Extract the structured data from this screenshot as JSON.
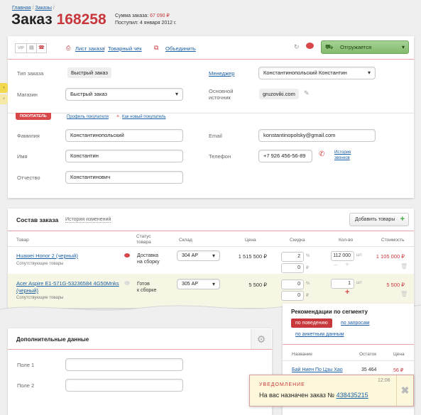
{
  "breadcrumb": [
    "Главная",
    "Заказы",
    "Заказ"
  ],
  "order": {
    "title_word": "Заказ",
    "number": "168258",
    "sum_label": "Сумма заказа:",
    "sum_value": "67 090 ₽",
    "received": "Поступил: 4 января 2012 г."
  },
  "toolbar": {
    "vip": "VIP",
    "order_sheet": "Лист заказа",
    "sep": "/",
    "receipt": "Товарный чек",
    "merge": "Объединить",
    "status": "Отгружается"
  },
  "info": {
    "type_label": "Тип заказа",
    "type_value": "Быстрый заказ",
    "store_label": "Магазин",
    "store_value": "Быстрый заказ",
    "manager_label": "Менеджер",
    "manager_value": "Константинопольский Константин",
    "source_label_1": "Основной",
    "source_label_2": "источник",
    "source_value": "gruzoviki.com"
  },
  "buyer": {
    "badge": "ПОКУПАТЕЛЬ",
    "profile_link": "Профиль покупателя",
    "new_link": "Как новый покупатель",
    "surname_label": "Фамилия",
    "surname_value": "Константинопольский",
    "name_label": "Имя",
    "name_value": "Константин",
    "patronymic_label": "Отчество",
    "patronymic_value": "Константинович",
    "email_label": "Email",
    "email_value": "konstantinopolsky@gmail.com",
    "phone_label": "Телефон",
    "phone_value": "+7 926 456-56-89",
    "call_history_1": "История",
    "call_history_2": "звонков"
  },
  "composition": {
    "title": "Состав заказа",
    "history": "История изменений",
    "add_button": "Добавить товары",
    "headers": {
      "item": "Товар",
      "status_1": "Статус",
      "status_2": "товара",
      "warehouse": "Склад",
      "price": "Цена",
      "discount": "Скидка",
      "qty": "Кол-во",
      "cost": "Стоимость"
    },
    "rows": [
      {
        "name": "Huawei Honor 2 (черный)",
        "related": "Сопутствующие товары",
        "status_1": "Доставка",
        "status_2": "на сборку",
        "warehouse": "304 АР",
        "price": "1 515 500 ₽",
        "disc_pct": "2",
        "disc_rub": "0",
        "qty": "112 000",
        "qty_unit": "шт",
        "cost": "1 105 000 ₽",
        "pct": "%",
        "rub": "₽"
      },
      {
        "name_1": "Acer Aspire E1-571G-53236584 4G50Mnks",
        "name_2": "(черный)",
        "related": "Сопутствующие товары",
        "status_1": "Готов",
        "status_2": "к сборке",
        "warehouse": "305 АР",
        "price": "5 500 ₽",
        "disc_pct": "0",
        "disc_rub": "0",
        "qty": "1",
        "qty_unit": "шт",
        "cost": "5 500 ₽",
        "pct": "%",
        "rub": "₽"
      }
    ]
  },
  "extra": {
    "title": "Дополнительные данные",
    "field1": "Поле 1",
    "field2": "Поле 2"
  },
  "recommend": {
    "title": "Рекомендации по сегменту",
    "tab_behavior": "по поведению",
    "tab_requests": "по запросам",
    "tab_survey": "по анкетным данным",
    "col_name": "Название",
    "col_stock": "Остаток",
    "col_price": "Цена",
    "row_name": "Бай Ниен По Цзы Хао",
    "row_stock": "35 464",
    "row_price": "56 ₽"
  },
  "notification": {
    "title": "УВЕДОМЛЕНИЕ",
    "time": "12:06",
    "text": "На вас назначен заказ №",
    "order_link": "438435215"
  },
  "colors": {
    "accent_red": "#c8373c",
    "status_green": "#8fc27a",
    "link_blue": "#1a5fa5"
  }
}
